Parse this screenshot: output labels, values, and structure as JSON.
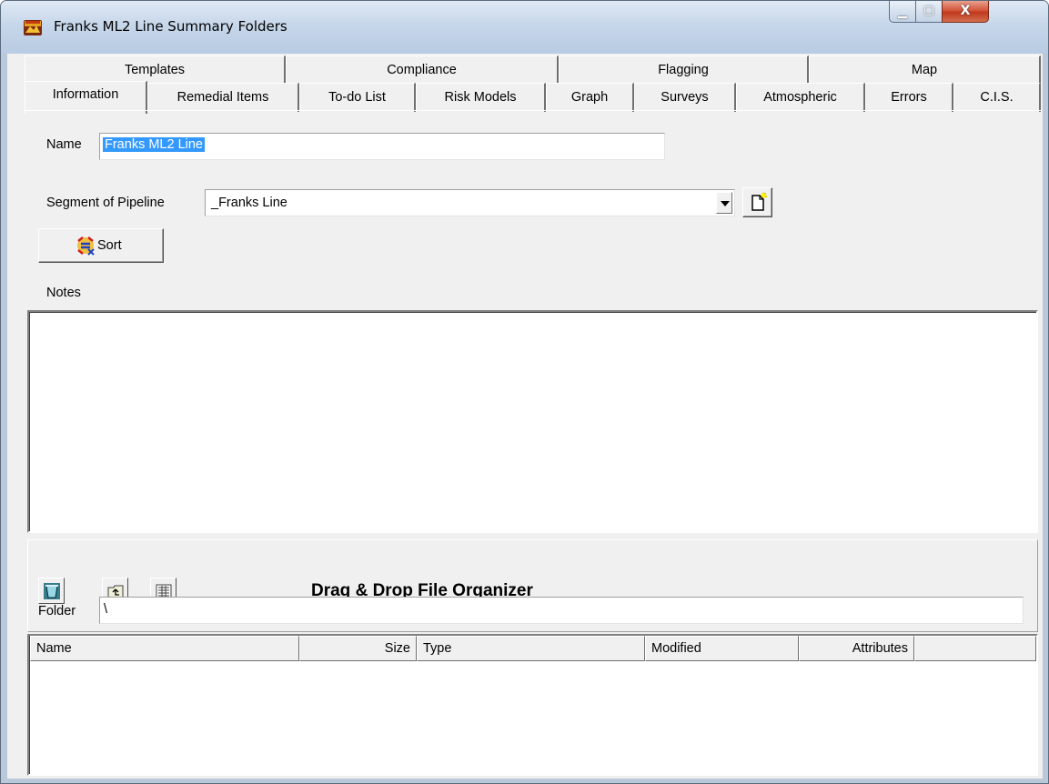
{
  "window": {
    "title": "Franks ML2 Line Summary Folders",
    "min_glyph": "▁",
    "max_glyph": "▢",
    "close_glyph": "X"
  },
  "tabs_back": [
    "Templates",
    "Compliance",
    "Flagging",
    "Map"
  ],
  "tabs_front": [
    "Information",
    "Remedial Items",
    "To-do List",
    "Risk Models",
    "Graph",
    "Surveys",
    "Atmospheric",
    "Errors",
    "C.I.S."
  ],
  "active_tab": "Information",
  "form": {
    "name_label": "Name",
    "name_value": "Franks ML2 Line",
    "segment_label": "Segment of Pipeline",
    "segment_value": "_Franks Line",
    "sort_label": "Sort",
    "notes_label": "Notes"
  },
  "organizer": {
    "title": "Drag & Drop File Organizer",
    "folder_label": "Folder",
    "folder_value": "\\"
  },
  "file_list": {
    "columns": [
      "Name",
      "Size",
      "Type",
      "Modified",
      "Attributes"
    ]
  },
  "icons": {
    "app": "app-logo-icon",
    "new_doc": "new-document-icon",
    "sort": "sort-icon",
    "recycle": "recycle-bin-icon",
    "up_folder": "up-folder-icon",
    "details_view": "details-view-icon"
  },
  "colors": {
    "selection": "#3399ff",
    "close_button": "#c0391e",
    "window_face": "#f0f0f0"
  }
}
